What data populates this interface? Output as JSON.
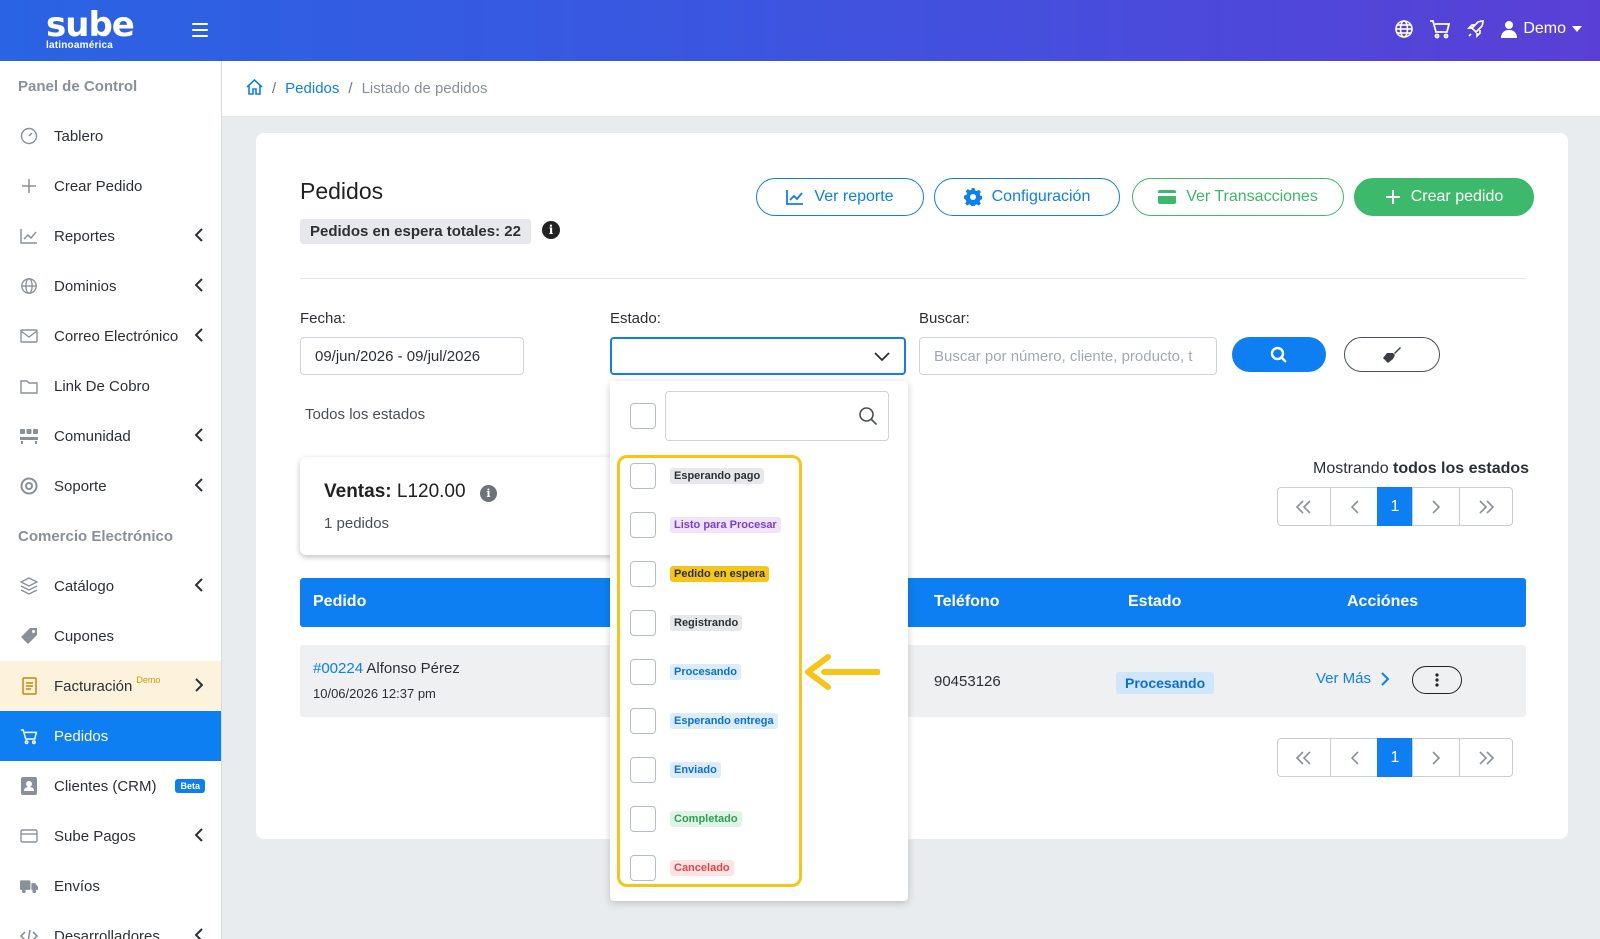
{
  "brand": {
    "name": "sube",
    "tagline": "latinoamérica"
  },
  "topbar": {
    "user": "Demo"
  },
  "sidebar": {
    "section1": "Panel de Control",
    "items1": [
      {
        "label": "Tablero",
        "icon": "speedometer-icon"
      },
      {
        "label": "Crear Pedido",
        "icon": "plus-icon"
      },
      {
        "label": "Reportes",
        "icon": "chart-icon"
      },
      {
        "label": "Dominios",
        "icon": "globe-icon"
      },
      {
        "label": "Correo Electrónico",
        "icon": "mail-icon"
      },
      {
        "label": "Link De Cobro",
        "icon": "folder-icon"
      },
      {
        "label": "Comunidad",
        "icon": "community-icon"
      },
      {
        "label": "Soporte",
        "icon": "lifebuoy-icon"
      }
    ],
    "section2": "Comercio Electrónico",
    "items2": [
      {
        "label": "Catálogo",
        "icon": "layers-icon"
      },
      {
        "label": "Cupones",
        "icon": "tag-icon"
      },
      {
        "label": "Facturación",
        "icon": "invoice-icon",
        "sup": "Demo"
      },
      {
        "label": "Pedidos",
        "icon": "cart-icon"
      },
      {
        "label": "Clientes (CRM)",
        "icon": "contacts-icon",
        "badge": "Beta"
      },
      {
        "label": "Sube Pagos",
        "icon": "card-icon"
      },
      {
        "label": "Envíos",
        "icon": "truck-icon"
      },
      {
        "label": "Desarrolladores",
        "icon": "code-icon"
      }
    ]
  },
  "breadcrumb": {
    "link": "Pedidos",
    "current": "Listado de pedidos"
  },
  "page": {
    "title": "Pedidos",
    "pending": "Pedidos en espera totales: 22",
    "buttons": {
      "report": "Ver reporte",
      "config": "Configuración",
      "transactions": "Ver Transacciones",
      "create": "Crear pedido"
    }
  },
  "filters": {
    "date_label": "Fecha:",
    "date_value": "09/jun/2026 - 09/jul/2026",
    "status_label": "Estado:",
    "search_label": "Buscar:",
    "search_placeholder": "Buscar por número, cliente, producto, t",
    "all_states": "Todos los estados"
  },
  "sales": {
    "label": "Ventas:",
    "amount": "L120.00",
    "orders": "1 pedidos"
  },
  "showing": {
    "prefix": "Mostrando",
    "bold": "todos los estados"
  },
  "pagination": {
    "current": "1"
  },
  "table": {
    "headers": {
      "order": "Pedido",
      "phone": "Teléfono",
      "status": "Estado",
      "actions": "Acciónes"
    },
    "rows": [
      {
        "number": "#00224",
        "customer": "Alfonso Pérez",
        "date": "10/06/2026 12:37 pm",
        "phone": "90453126",
        "status": "Procesando",
        "more": "Ver Más"
      }
    ]
  },
  "status_options": [
    {
      "label": "Esperando pago",
      "bg": "#e6e8eb",
      "fg": "#2c3036"
    },
    {
      "label": "Listo para Procesar",
      "bg": "#efe4fb",
      "fg": "#7a3fcf"
    },
    {
      "label": "Pedido en espera",
      "bg": "#f5c518",
      "fg": "#2c3036"
    },
    {
      "label": "Registrando",
      "bg": "#e6e8eb",
      "fg": "#2c3036"
    },
    {
      "label": "Procesando",
      "bg": "#dcecfc",
      "fg": "#0d6fd0"
    },
    {
      "label": "Esperando entrega",
      "bg": "#dcecfc",
      "fg": "#0d6fd0"
    },
    {
      "label": "Enviado",
      "bg": "#dcecfc",
      "fg": "#0d6fd0"
    },
    {
      "label": "Completado",
      "bg": "#e0f4e6",
      "fg": "#2f9e55"
    },
    {
      "label": "Cancelado",
      "bg": "#fde3e3",
      "fg": "#d94848"
    }
  ],
  "colors": {
    "primary": "#0d7ff2",
    "success": "#3cb96a",
    "highlight": "#f5c518"
  }
}
